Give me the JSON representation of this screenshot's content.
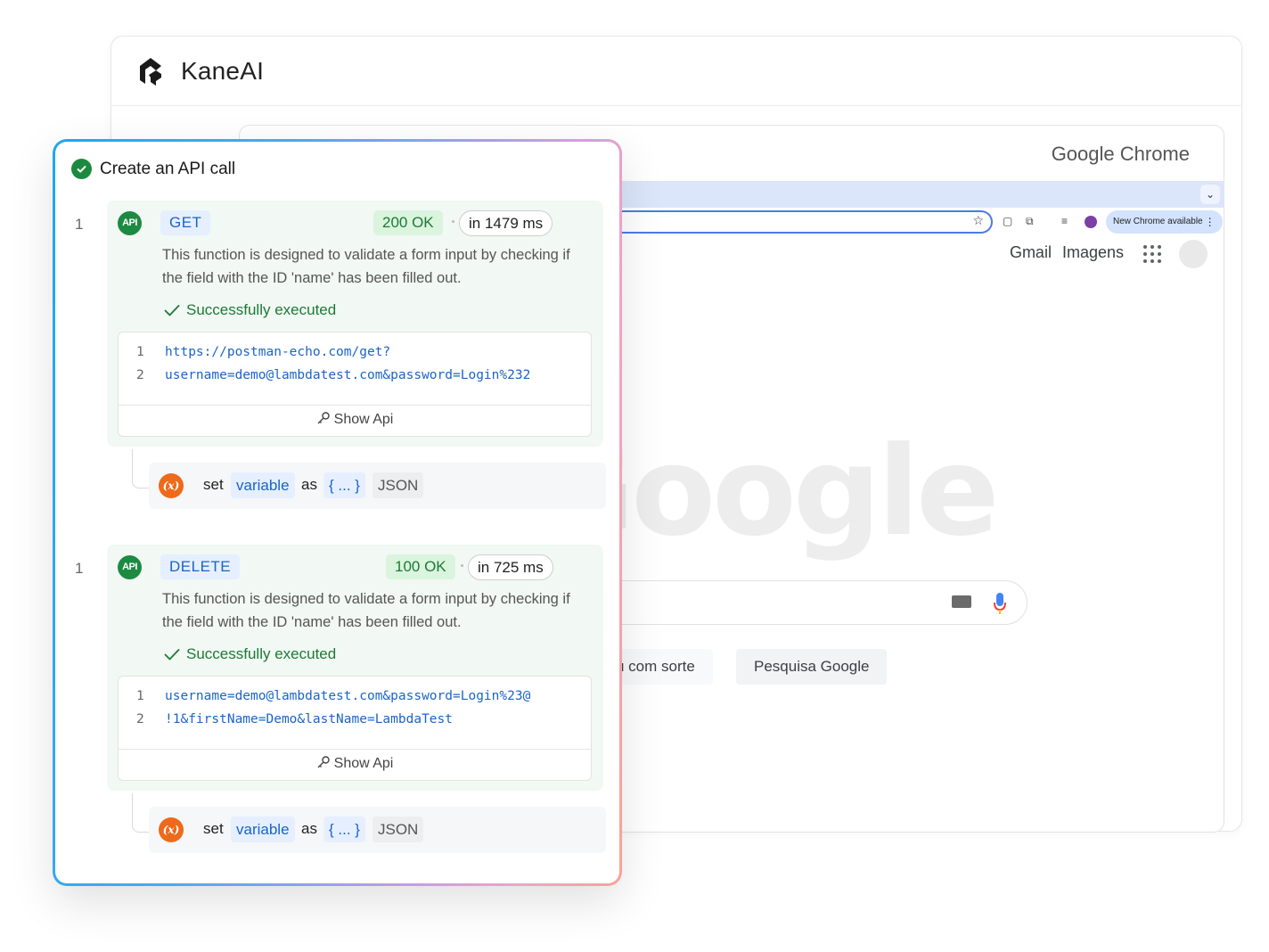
{
  "app": {
    "name": "KaneAI"
  },
  "browser": {
    "window_title": "Google Chrome",
    "update_badge": "New Chrome available",
    "top_links": [
      "Gmail",
      "Imagens"
    ],
    "logo_text": "Google",
    "buttons": {
      "lucky": "u com sorte",
      "search": "Pesquisa Google"
    }
  },
  "card": {
    "title": "Create an API call",
    "steps": [
      {
        "number": "1",
        "icon_label": "API",
        "method": "GET",
        "status": "200 OK",
        "timing": "in 1479 ms",
        "description": "This function is designed to validate a form input by checking if the field with the ID 'name' has been filled out.",
        "result": "Successfully executed",
        "code": [
          {
            "ln": "1",
            "text": "https://postman-echo.com/get?"
          },
          {
            "ln": "2",
            "text": "username=demo@lambdatest.com&password=Login%232"
          }
        ],
        "show_api": "Show Api",
        "set": {
          "icon": "(x)",
          "keyword": "set",
          "var": "variable",
          "as": "as",
          "value": "{ ... }",
          "type": "JSON"
        }
      },
      {
        "number": "1",
        "icon_label": "API",
        "method": "DELETE",
        "status": "100 OK",
        "timing": "in 725 ms",
        "description": "This function is designed to validate a form input by checking if the field with the ID 'name' has been filled out.",
        "result": "Successfully executed",
        "code": [
          {
            "ln": "1",
            "text": "username=demo@lambdatest.com&password=Login%23@"
          },
          {
            "ln": "2",
            "text": "!1&firstName=Demo&lastName=LambdaTest"
          }
        ],
        "show_api": "Show Api",
        "set": {
          "icon": "(x)",
          "keyword": "set",
          "var": "variable",
          "as": "as",
          "value": "{ ... }",
          "type": "JSON"
        }
      }
    ]
  },
  "colors": {
    "accent_blue": "#1b64c7",
    "success_green": "#1c7a35",
    "api_green": "#1d8a42",
    "var_orange": "#ee6a1b"
  }
}
